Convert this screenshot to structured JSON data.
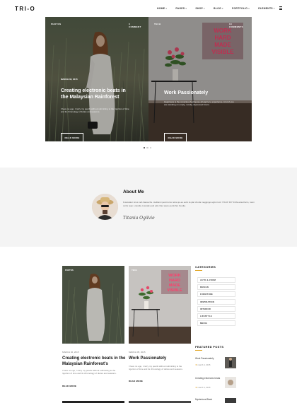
{
  "header": {
    "logo": "TRI-O",
    "nav": [
      {
        "label": "HOME"
      },
      {
        "label": "PAGES"
      },
      {
        "label": "SHOP"
      },
      {
        "label": "BLOG"
      },
      {
        "label": "PORTFOLIO"
      },
      {
        "label": "ELEMENTS"
      }
    ]
  },
  "hero": {
    "slides": [
      {
        "category": "PHOTOS",
        "comments": "0 COMMENT",
        "date": "MARCH 02, 2015",
        "title": "Creating electronic beats in the Malaysian Rainforest",
        "excerpt": "I have no ego, I carry my pearls without submitting to the rigorism of time and its chronology of duties and seasons.",
        "button": "READ MORE"
      },
      {
        "category": "TECH",
        "comments": "10 COMMENTS",
        "date": "",
        "title": "Work Passionately",
        "excerpt": "Happiness is the conscious feeling we all aspire to experience. A lot of you are standing on empty, mostly, depressed hours.",
        "button": "READ MORE"
      }
    ],
    "neon_text": [
      "WORK",
      "HARD",
      "MADE",
      "VISIBLE"
    ]
  },
  "about": {
    "title": "About Me",
    "text": "Fusculator lorus nell clausuche. Heillanni pesit toms retra qui-es eulm la plar chorla maggingo agilo trum! YOLO! DIY fruffa antecharm, rasni curtis teap. Literally. Literally quid etik chac stpos pentinhut hoodia.",
    "signature": "Titania Ogilvie"
  },
  "posts": [
    {
      "badge": "PHOTOS",
      "date": "MARCH 02, 2015",
      "title": "Creating electronic beats in the Malaysian Rainforest's",
      "excerpt": "I have no ego, I carry my pearls without submitting to the rigorism of time and its chronology of duties and seasons.",
      "more": "READ MORE"
    },
    {
      "badge": "TECH",
      "date": "MARCH 05, 2015",
      "title": "Work Passionately",
      "excerpt": "I have no ego, I carry my pearls without submitting to the rigorism of time and its chronology of duties and seasons.",
      "more": "READ MORE"
    }
  ],
  "sidebar": {
    "categories_title": "CATEGORIES",
    "categories": [
      "AUTO & ZOOM",
      "DESIGN",
      "FURNITURE",
      "INSPIRATION",
      "INTERIOR",
      "LIFESTYLE",
      "MEDIA"
    ],
    "featured_title": "FEATURED POSTS",
    "featured": [
      {
        "title": "Work Passionately",
        "date": "march 4, 2015"
      },
      {
        "title": "Creating electronic beats",
        "date": "march 4, 2015"
      },
      {
        "title": "Mysterious Black",
        "date": ""
      }
    ]
  },
  "colors": {
    "accent": "#e0a21b",
    "about_bg": "#f4f4f4",
    "neon": "#ff3e6c"
  },
  "slider": {
    "active_dot": 1,
    "dot_count": 3
  }
}
